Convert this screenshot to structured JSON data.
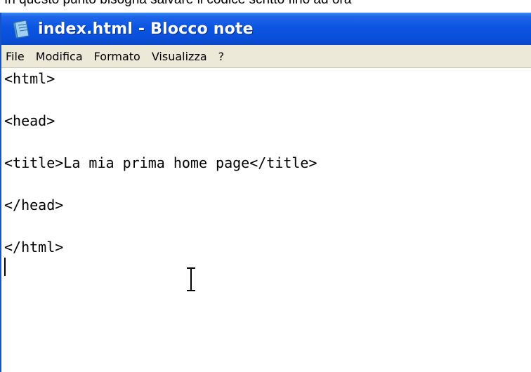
{
  "top_text": "In questo punto bisogna salvare il codice scritto fino ad ora",
  "window": {
    "title": "index.html - Blocco note",
    "icon": "notepad-icon"
  },
  "menu": [
    {
      "label": "File"
    },
    {
      "label": "Modifica"
    },
    {
      "label": "Formato"
    },
    {
      "label": "Visualizza"
    },
    {
      "label": "?"
    }
  ],
  "editor": {
    "lines": [
      "<html>",
      "",
      "<head>",
      "",
      "<title>La mia prima home page</title>",
      "",
      "</head>",
      "",
      "</html>"
    ]
  },
  "colors": {
    "titlebar": "#0a50dc",
    "menubar": "#ece9d8"
  }
}
